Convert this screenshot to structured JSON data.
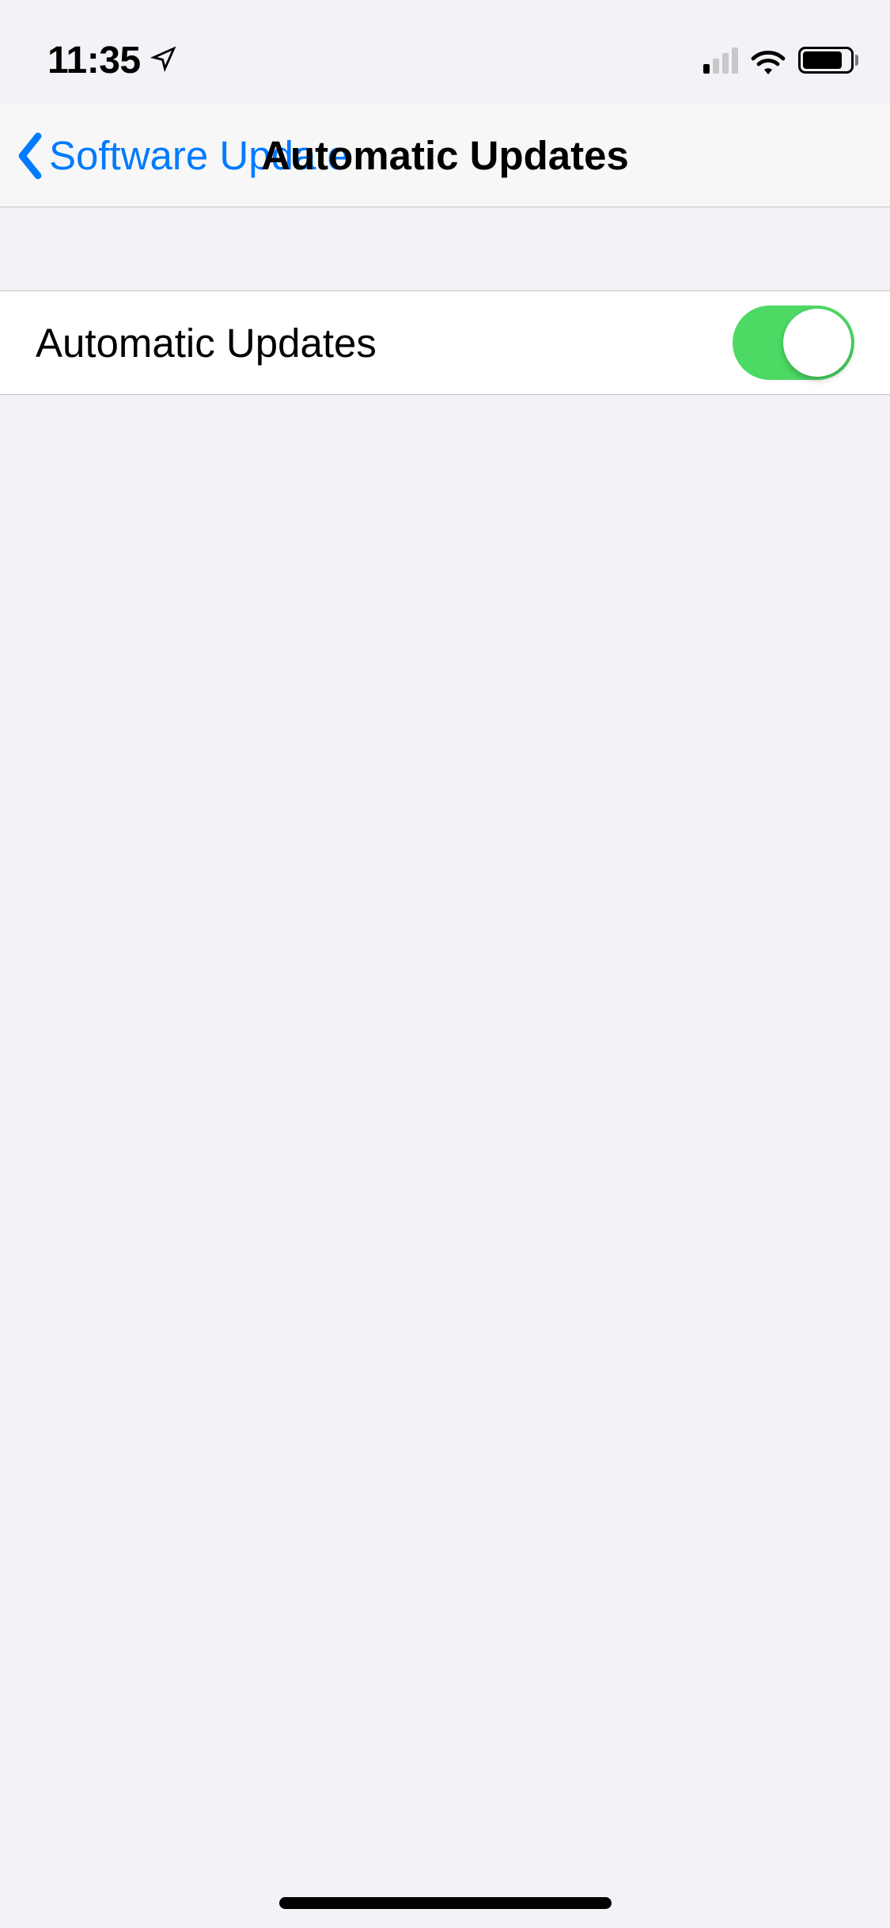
{
  "statusBar": {
    "time": "11:35",
    "signalBars": 1,
    "batteryPercent": 85
  },
  "nav": {
    "backLabel": "Software Update",
    "title": "Automatic Updates"
  },
  "settings": {
    "autoUpdates": {
      "label": "Automatic Updates",
      "enabled": true
    }
  },
  "colors": {
    "accent": "#007aff",
    "toggleOn": "#4cd964"
  }
}
